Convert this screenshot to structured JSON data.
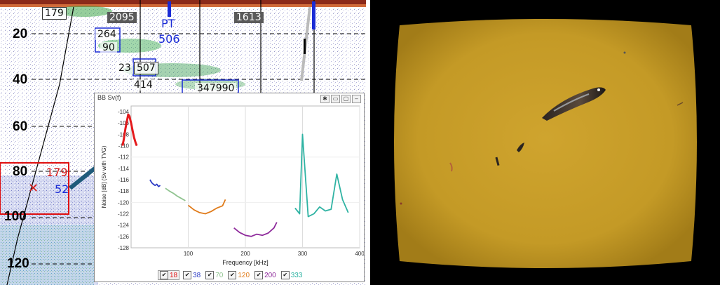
{
  "echogram": {
    "depth_labels": [
      "20",
      "40",
      "60",
      "80",
      "100",
      "120"
    ],
    "tags": [
      {
        "id": "t179",
        "text": "179"
      },
      {
        "id": "t2095",
        "text": "2095"
      },
      {
        "id": "t264",
        "text": "264"
      },
      {
        "id": "t90",
        "text": "90"
      },
      {
        "id": "t23",
        "text": "23"
      },
      {
        "id": "t507",
        "text": "507"
      },
      {
        "id": "t414",
        "text": "414"
      },
      {
        "id": "t1613",
        "text": "1613"
      },
      {
        "id": "t347990",
        "text": "347990"
      }
    ],
    "pt_label": "PT",
    "pt_value": "506",
    "selection": {
      "red_value": "179",
      "blue_value": "52",
      "marker": "✕"
    }
  },
  "popup": {
    "title": "BB Sv(f)",
    "buttons": [
      "✱",
      "▭",
      "▢",
      "–"
    ]
  },
  "chart_data": {
    "type": "line",
    "title": "",
    "xlabel": "Frequency [kHz]",
    "ylabel": "Noise [dB] (Sv with TVG)",
    "xlim": [
      0,
      400
    ],
    "ylim": [
      -128,
      -103
    ],
    "x_ticks": [
      100,
      200,
      300,
      400
    ],
    "y_ticks": [
      -104,
      -106,
      -108,
      -110,
      -112,
      -114,
      -116,
      -118,
      -120,
      -122,
      -124,
      -126,
      -128
    ],
    "grid": true,
    "legend_placement": "bottom",
    "series": [
      {
        "name": "18",
        "color": "#e41a1c",
        "x": [
          -15,
          -13,
          -10,
          -7,
          -5,
          -3,
          0,
          3,
          5,
          8,
          10
        ],
        "y": [
          -110,
          -109,
          -107,
          -105.5,
          -104.5,
          -104.8,
          -106,
          -107.5,
          -108.5,
          -109.5,
          -110
        ]
      },
      {
        "name": "38",
        "color": "#2a39c4",
        "x": [
          33,
          36,
          39,
          42,
          45,
          48,
          51
        ],
        "y": [
          -116,
          -116.5,
          -116.8,
          -117,
          -116.8,
          -117.2,
          -117
        ]
      },
      {
        "name": "70",
        "color": "#8fc38f",
        "x": [
          60,
          67,
          74,
          81,
          88,
          95
        ],
        "y": [
          -117.5,
          -118,
          -118.4,
          -118.9,
          -119.3,
          -119.7
        ]
      },
      {
        "name": "120",
        "color": "#e07b1a",
        "x": [
          100,
          110,
          120,
          130,
          140,
          150,
          160,
          165
        ],
        "y": [
          -120.5,
          -121.3,
          -121.8,
          -122,
          -121.6,
          -121,
          -120.6,
          -119.5
        ]
      },
      {
        "name": "200",
        "color": "#8e2a9b",
        "x": [
          180,
          190,
          200,
          210,
          220,
          230,
          240,
          250,
          255
        ],
        "y": [
          -124.5,
          -125.3,
          -125.8,
          -126,
          -125.6,
          -125.8,
          -125.4,
          -124.5,
          -123.5
        ]
      },
      {
        "name": "333",
        "color": "#2fb3a3",
        "x": [
          287,
          295,
          300,
          310,
          320,
          330,
          340,
          350,
          360,
          370,
          380
        ],
        "y": [
          -121,
          -122,
          -108,
          -122.5,
          -122,
          -120.8,
          -121.5,
          -121.2,
          -115,
          -119.5,
          -121.8
        ]
      }
    ]
  },
  "camera": {}
}
